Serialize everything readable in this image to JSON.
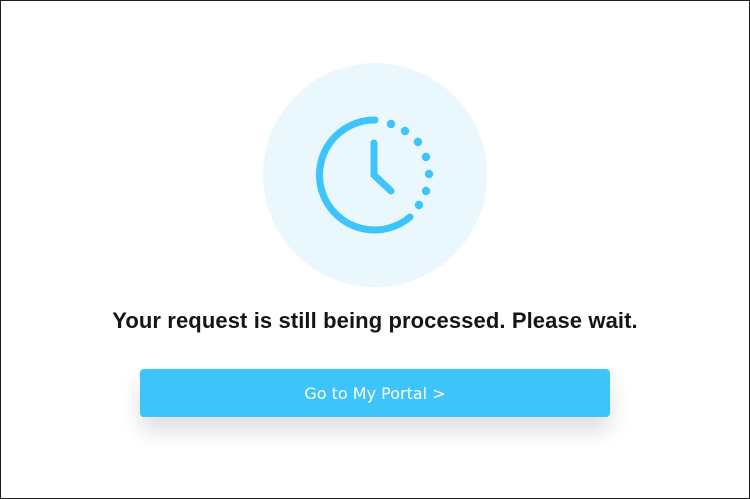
{
  "status": {
    "icon": "clock-pending-icon",
    "message": "Your request is still being processed. Please wait."
  },
  "actions": {
    "portal_button_label": "Go to My Portal >"
  },
  "colors": {
    "accent": "#3dc4fb",
    "icon_background": "#eaf7fd",
    "text": "#151515"
  }
}
